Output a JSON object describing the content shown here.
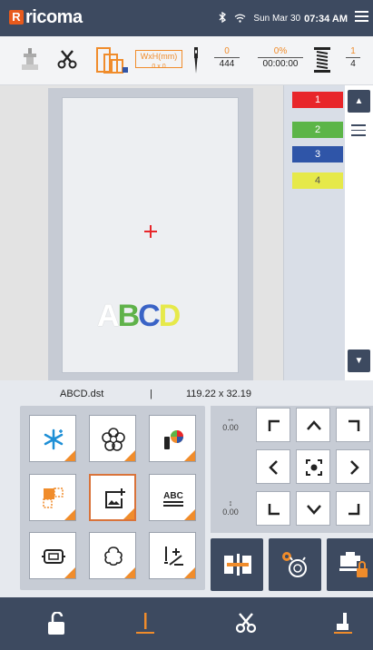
{
  "app": {
    "logo_text": "ricoma",
    "logo_mark": "R"
  },
  "status_bar": {
    "date": "Sun Mar 30",
    "time": "07:34 AM"
  },
  "toolbar": {
    "size_label": "WxH(mm)",
    "size_value": "0 x 0",
    "stitch_current": "0",
    "stitch_total": "444",
    "progress_percent": "0%",
    "elapsed_time": "00:00:00",
    "color_current": "1",
    "color_total": "4"
  },
  "design": {
    "letters": [
      "A",
      "B",
      "C",
      "D"
    ],
    "letter_colors": [
      "#ffffff",
      "#5fb24a",
      "#3a63c6",
      "#e6e94a"
    ]
  },
  "color_sequence": [
    {
      "number": "1",
      "color": "#e8262a"
    },
    {
      "number": "2",
      "color": "#5cb548"
    },
    {
      "number": "3",
      "color": "#2f55a8"
    },
    {
      "number": "4",
      "color": "#e6e94a"
    }
  ],
  "file_info": {
    "filename": "ABCD.dst",
    "separator": "|",
    "dimensions": "119.22 x 32.19"
  },
  "jog": {
    "x_offset": "0.00",
    "y_offset": "0.00"
  },
  "accent_color": "#f08c2b",
  "theme_color": "#3d4a60"
}
